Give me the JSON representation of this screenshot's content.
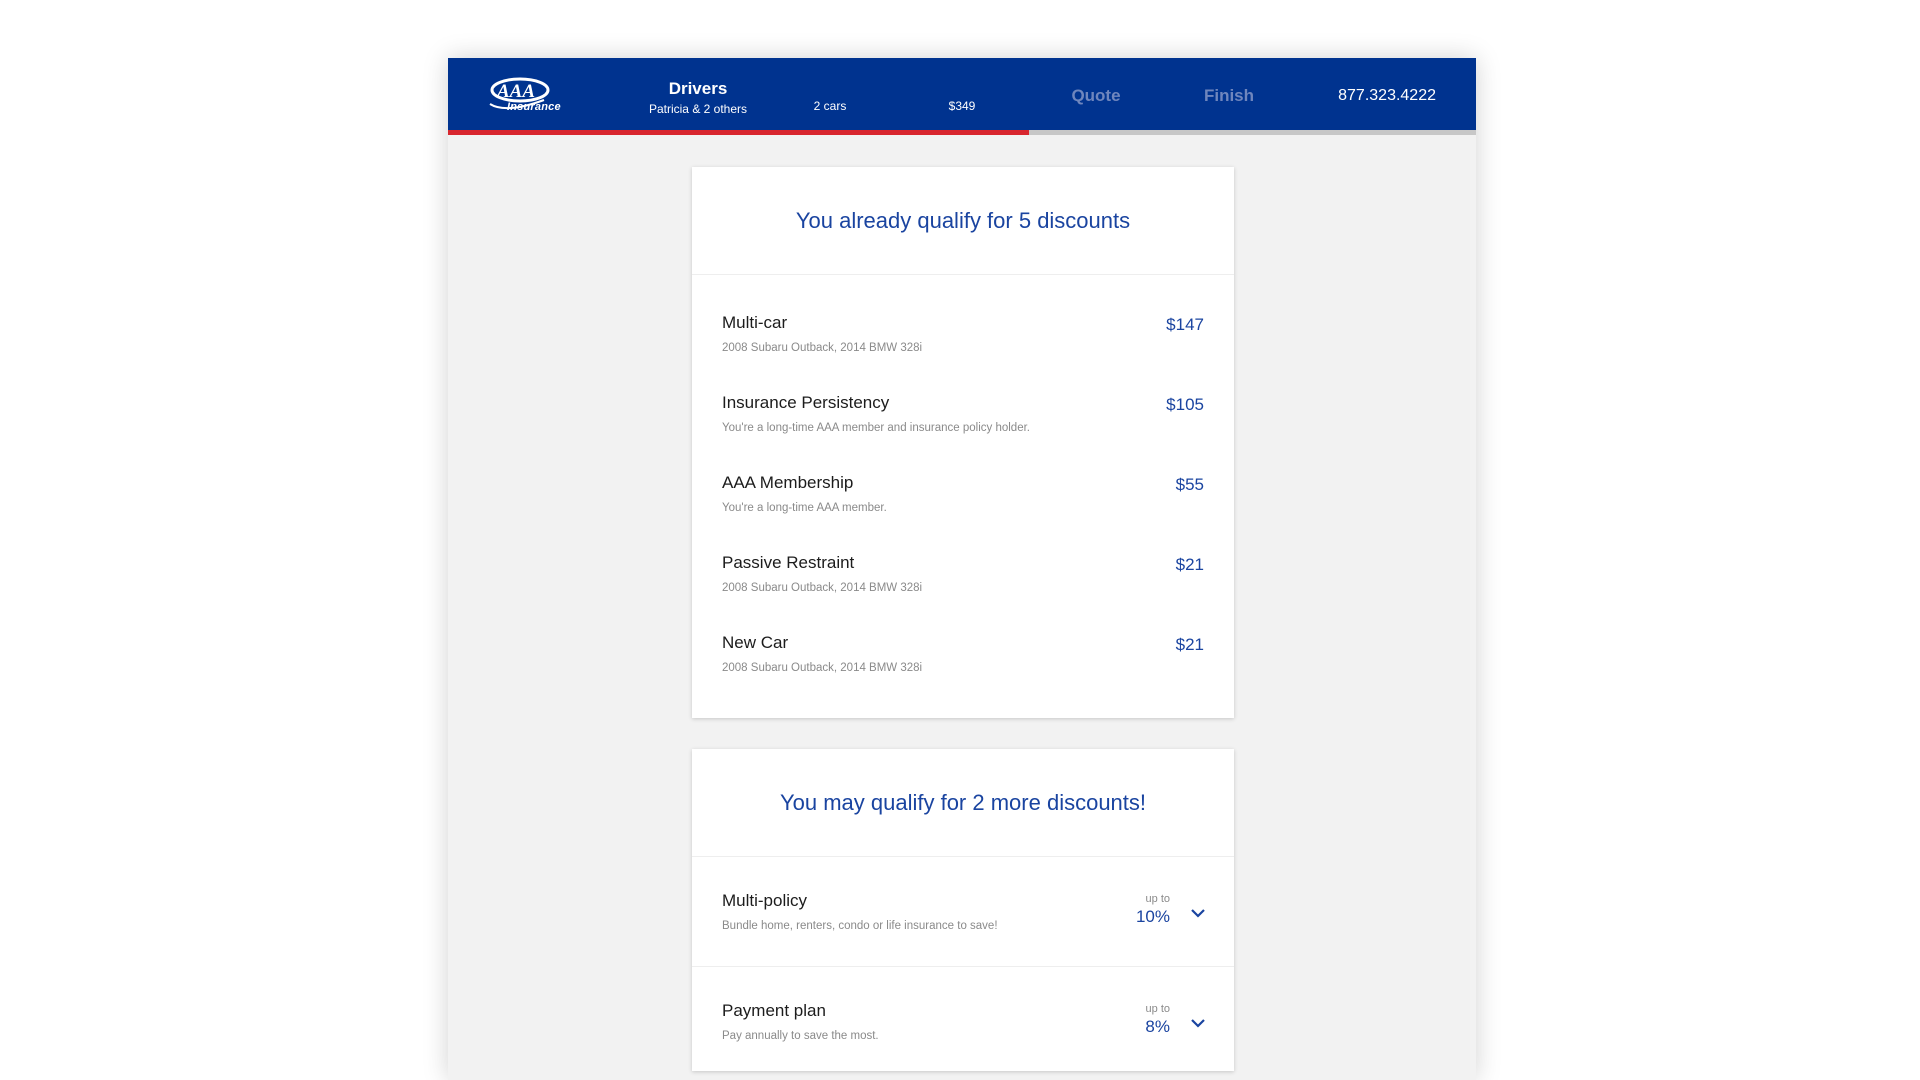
{
  "header": {
    "logo_text": "Insurance",
    "steps": {
      "drivers": {
        "title": "Drivers",
        "subtitle": "Patricia & 2 others"
      },
      "cars": "2 cars",
      "price": "$349",
      "quote": "Quote",
      "finish": "Finish"
    },
    "phone": "877.323.4222",
    "progress_percent": 56.5
  },
  "qualified": {
    "title": "You already qualify for 5 discounts",
    "items": [
      {
        "name": "Multi-car",
        "desc": "2008 Subaru Outback, 2014 BMW 328i",
        "amount": "$147"
      },
      {
        "name": "Insurance Persistency",
        "desc": "You're a long-time AAA member and insurance policy holder.",
        "amount": "$105"
      },
      {
        "name": "AAA Membership",
        "desc": "You're a long-time AAA member.",
        "amount": "$55"
      },
      {
        "name": "Passive Restraint",
        "desc": "2008 Subaru Outback, 2014 BMW 328i",
        "amount": "$21"
      },
      {
        "name": "New Car",
        "desc": "2008 Subaru Outback, 2014 BMW 328i",
        "amount": "$21"
      }
    ]
  },
  "more": {
    "title": "You may qualify for 2 more discounts!",
    "items": [
      {
        "name": "Multi-policy",
        "desc": "Bundle home, renters, condo or life insurance to save!",
        "upto": "up to",
        "pct": "10%"
      },
      {
        "name": "Payment plan",
        "desc": "Pay annually to save the most.",
        "upto": "up to",
        "pct": "8%"
      }
    ]
  },
  "colors": {
    "brand_blue": "#00338f",
    "accent_red": "#d8262e",
    "link_blue": "#1a44a0"
  }
}
